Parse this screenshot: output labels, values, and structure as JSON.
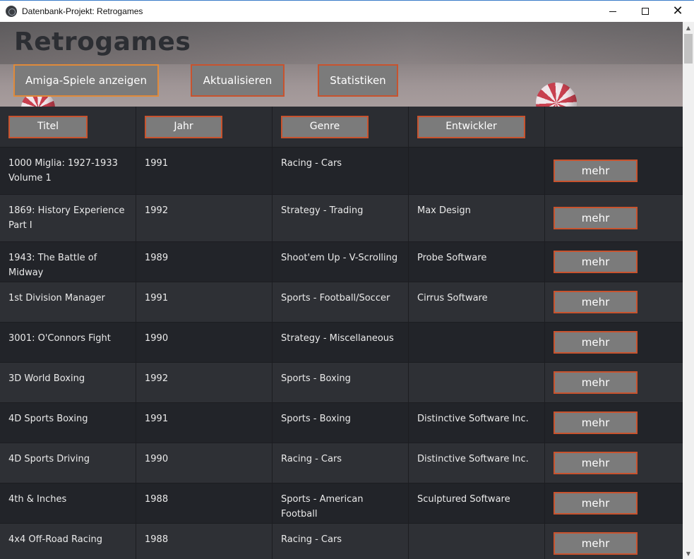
{
  "window": {
    "title": "Datenbank-Projekt: Retrogames",
    "minimize_glyph": "",
    "maximize_glyph": "",
    "close_glyph": "✕"
  },
  "header": {
    "title": "Retrogames",
    "buttons": {
      "amiga": "Amiga-Spiele anzeigen",
      "refresh": "Aktualisieren",
      "stats": "Statistiken"
    }
  },
  "table": {
    "columns": {
      "title": "Titel",
      "year": "Jahr",
      "genre": "Genre",
      "developer": "Entwickler"
    },
    "more_label": "mehr",
    "rows": [
      {
        "title": "1000 Miglia: 1927-1933 Volume 1",
        "year": "1991",
        "genre": "Racing - Cars",
        "developer": ""
      },
      {
        "title": "1869: History Experience Part I",
        "year": "1992",
        "genre": "Strategy - Trading",
        "developer": "Max Design"
      },
      {
        "title": "1943: The Battle of Midway",
        "year": "1989",
        "genre": "Shoot'em Up - V-Scrolling",
        "developer": "Probe Software"
      },
      {
        "title": "1st Division Manager",
        "year": "1991",
        "genre": "Sports - Football/Soccer",
        "developer": "Cirrus Software"
      },
      {
        "title": "3001: O'Connors Fight",
        "year": "1990",
        "genre": "Strategy - Miscellaneous",
        "developer": ""
      },
      {
        "title": "3D World Boxing",
        "year": "1992",
        "genre": "Sports - Boxing",
        "developer": ""
      },
      {
        "title": "4D Sports Boxing",
        "year": "1991",
        "genre": "Sports - Boxing",
        "developer": "Distinctive Software Inc."
      },
      {
        "title": "4D Sports Driving",
        "year": "1990",
        "genre": "Racing - Cars",
        "developer": "Distinctive Software Inc."
      },
      {
        "title": "4th & Inches",
        "year": "1988",
        "genre": "Sports - American Football",
        "developer": "Sculptured Software"
      },
      {
        "title": "4x4 Off-Road Racing",
        "year": "1988",
        "genre": "Racing - Cars",
        "developer": ""
      }
    ]
  },
  "colors": {
    "accent_border": "#c8532e",
    "button_bg": "#7b7b7b",
    "row_dark": "#222429",
    "row_light": "#2e3035"
  }
}
